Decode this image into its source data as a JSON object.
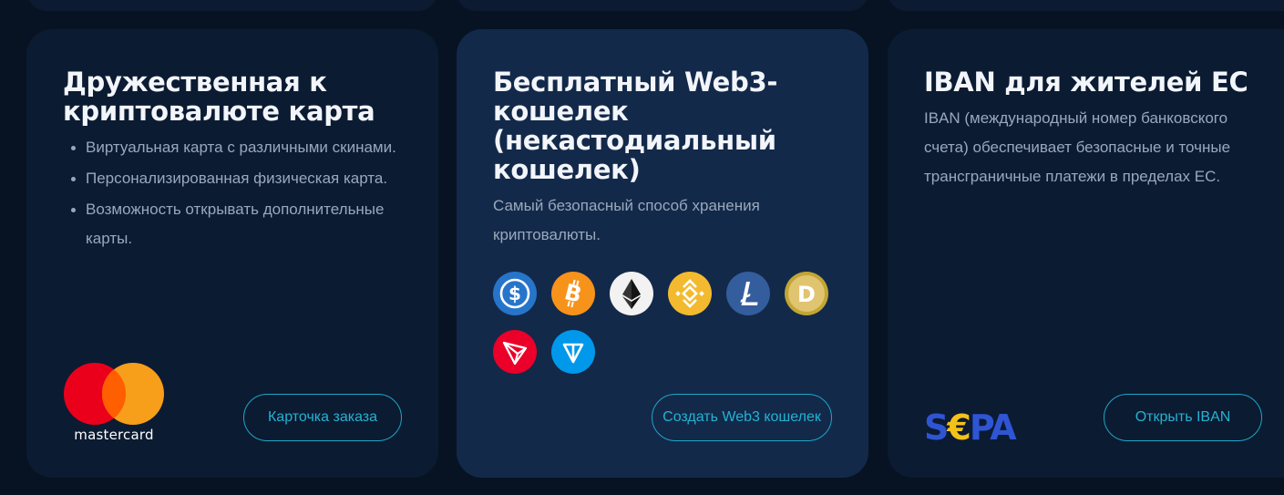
{
  "cards": [
    {
      "title": "Дружественная к криптовалюте карта",
      "features": [
        "Виртуальная карта с различными скинами.",
        "Персонализированная физическая карта.",
        "Возможность открывать дополнительные карты."
      ],
      "logo": {
        "icon": "mastercard-logo",
        "label": "mastercard"
      },
      "button_label": "Карточка заказа"
    },
    {
      "title": "Бесплатный Web3-кошелек (некастодиальный кошелек)",
      "description": "Самый безопасный способ хранения криптовалюты.",
      "coins": [
        {
          "icon": "usdc-icon",
          "color": "#2775ca"
        },
        {
          "icon": "bitcoin-icon",
          "color": "#f7931a"
        },
        {
          "icon": "ethereum-icon",
          "color": "#f2f2f2"
        },
        {
          "icon": "bnb-icon",
          "color": "#f3ba2f"
        },
        {
          "icon": "litecoin-icon",
          "color": "#345d9d"
        },
        {
          "icon": "dogecoin-icon",
          "color": "#c2a633"
        },
        {
          "icon": "tron-icon",
          "color": "#eb0029"
        },
        {
          "icon": "ton-icon",
          "color": "#0098ea"
        }
      ],
      "button_label": "Создать Web3 кошелек"
    },
    {
      "title": "IBAN для жителей ЕС",
      "description": "IBAN (международный номер банковского счета) обеспечивает безопасные и точные трансграничные платежи в пределах ЕС.",
      "logo": {
        "icon": "sepa-logo",
        "text_s": "S",
        "text_euro": "€",
        "text_pa": "PA"
      },
      "button_label": "Открыть IBAN"
    }
  ],
  "colors": {
    "page_background": "#071322",
    "card_background": "#0b1b32",
    "card_highlight_background": "#13294a",
    "title": "#f2f5fa",
    "body_text": "#9aa8bc",
    "accent": "#23b3d2"
  }
}
